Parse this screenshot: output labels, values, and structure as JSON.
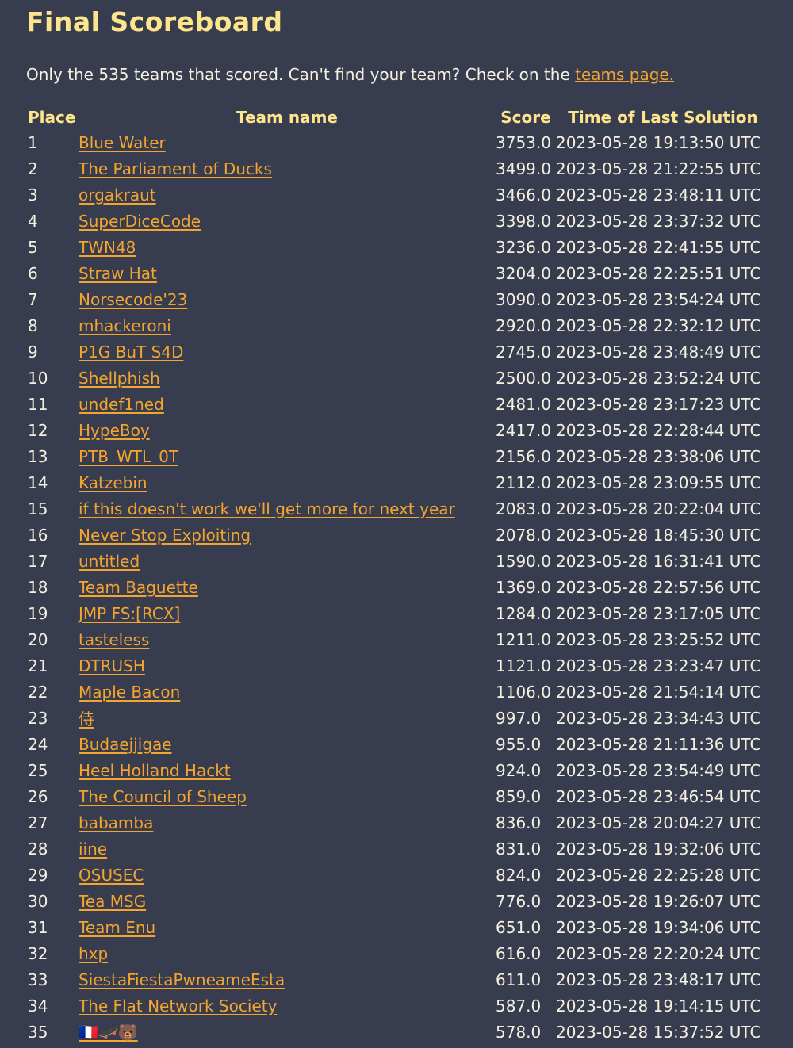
{
  "page": {
    "title": "Final Scoreboard",
    "intro_text": "Only the 535 teams that scored. Can't find your team? Check on the ",
    "intro_link": "teams page."
  },
  "table": {
    "headers": {
      "place": "Place",
      "team": "Team name",
      "score": "Score",
      "time": "Time of Last Solution"
    },
    "rows": [
      {
        "place": "1",
        "team": "Blue Water",
        "score": "3753.0",
        "time": "2023-05-28 19:13:50 UTC"
      },
      {
        "place": "2",
        "team": "The Parliament of Ducks",
        "score": "3499.0",
        "time": "2023-05-28 21:22:55 UTC"
      },
      {
        "place": "3",
        "team": "orgakraut",
        "score": "3466.0",
        "time": "2023-05-28 23:48:11 UTC"
      },
      {
        "place": "4",
        "team": "SuperDiceCode",
        "score": "3398.0",
        "time": "2023-05-28 23:37:32 UTC"
      },
      {
        "place": "5",
        "team": "TWN48",
        "score": "3236.0",
        "time": "2023-05-28 22:41:55 UTC"
      },
      {
        "place": "6",
        "team": "Straw Hat",
        "score": "3204.0",
        "time": "2023-05-28 22:25:51 UTC"
      },
      {
        "place": "7",
        "team": "Norsecode'23",
        "score": "3090.0",
        "time": "2023-05-28 23:54:24 UTC"
      },
      {
        "place": "8",
        "team": "mhackeroni",
        "score": "2920.0",
        "time": "2023-05-28 22:32:12 UTC"
      },
      {
        "place": "9",
        "team": "P1G BuT S4D",
        "score": "2745.0",
        "time": "2023-05-28 23:48:49 UTC"
      },
      {
        "place": "10",
        "team": "Shellphish",
        "score": "2500.0",
        "time": "2023-05-28 23:52:24 UTC"
      },
      {
        "place": "11",
        "team": "undef1ned",
        "score": "2481.0",
        "time": "2023-05-28 23:17:23 UTC"
      },
      {
        "place": "12",
        "team": "HypeBoy",
        "score": "2417.0",
        "time": "2023-05-28 22:28:44 UTC"
      },
      {
        "place": "13",
        "team": "PTB_WTL_0T",
        "score": "2156.0",
        "time": "2023-05-28 23:38:06 UTC"
      },
      {
        "place": "14",
        "team": "Katzebin",
        "score": "2112.0",
        "time": "2023-05-28 23:09:55 UTC"
      },
      {
        "place": "15",
        "team": "if this doesn't work we'll get more for next year",
        "score": "2083.0",
        "time": "2023-05-28 20:22:04 UTC"
      },
      {
        "place": "16",
        "team": "Never Stop Exploiting",
        "score": "2078.0",
        "time": "2023-05-28 18:45:30 UTC"
      },
      {
        "place": "17",
        "team": "untitled",
        "score": "1590.0",
        "time": "2023-05-28 16:31:41 UTC"
      },
      {
        "place": "18",
        "team": "Team Baguette",
        "score": "1369.0",
        "time": "2023-05-28 22:57:56 UTC"
      },
      {
        "place": "19",
        "team": "JMP FS:[RCX]",
        "score": "1284.0",
        "time": "2023-05-28 23:17:05 UTC"
      },
      {
        "place": "20",
        "team": "tasteless",
        "score": "1211.0",
        "time": "2023-05-28 23:25:52 UTC"
      },
      {
        "place": "21",
        "team": "DTRUSH",
        "score": "1121.0",
        "time": "2023-05-28 23:23:47 UTC"
      },
      {
        "place": "22",
        "team": "Maple Bacon",
        "score": "1106.0",
        "time": "2023-05-28 21:54:14 UTC"
      },
      {
        "place": "23",
        "team": "侍",
        "score": "997.0",
        "time": "2023-05-28 23:34:43 UTC"
      },
      {
        "place": "24",
        "team": "Budaejjigae",
        "score": "955.0",
        "time": "2023-05-28 21:11:36 UTC"
      },
      {
        "place": "25",
        "team": "Heel Holland Hackt",
        "score": "924.0",
        "time": "2023-05-28 23:54:49 UTC"
      },
      {
        "place": "26",
        "team": "The Council of Sheep",
        "score": "859.0",
        "time": "2023-05-28 23:46:54 UTC"
      },
      {
        "place": "27",
        "team": "babamba",
        "score": "836.0",
        "time": "2023-05-28 20:04:27 UTC"
      },
      {
        "place": "28",
        "team": "iine",
        "score": "831.0",
        "time": "2023-05-28 19:32:06 UTC"
      },
      {
        "place": "29",
        "team": "OSUSEC",
        "score": "824.0",
        "time": "2023-05-28 22:25:28 UTC"
      },
      {
        "place": "30",
        "team": "Tea MSG",
        "score": "776.0",
        "time": "2023-05-28 19:26:07 UTC"
      },
      {
        "place": "31",
        "team": "Team Enu",
        "score": "651.0",
        "time": "2023-05-28 19:34:06 UTC"
      },
      {
        "place": "32",
        "team": "hxp",
        "score": "616.0",
        "time": "2023-05-28 22:20:24 UTC"
      },
      {
        "place": "33",
        "team": "SiestaFiestaPwneameEsta",
        "score": "611.0",
        "time": "2023-05-28 23:48:17 UTC"
      },
      {
        "place": "34",
        "team": "The Flat Network Society",
        "score": "587.0",
        "time": "2023-05-28 19:14:15 UTC"
      },
      {
        "place": "35",
        "team": "🇫🇷🛹🐻",
        "score": "578.0",
        "time": "2023-05-28 15:37:52 UTC"
      }
    ]
  },
  "colors": {
    "background": "#373c4e",
    "heading": "#fde58c",
    "link": "#f4a52f",
    "text": "#f5f1e1"
  }
}
